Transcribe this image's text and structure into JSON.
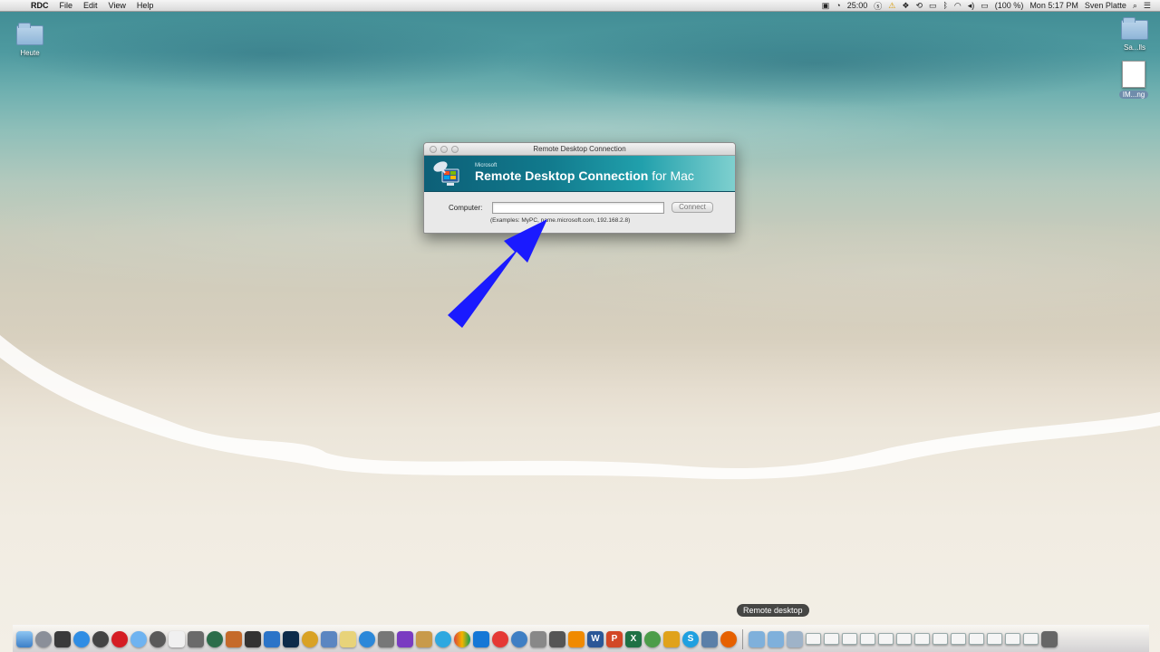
{
  "menubar": {
    "app": "RDC",
    "items": [
      "File",
      "Edit",
      "View",
      "Help"
    ],
    "time_remaining": "25:00",
    "battery": "(100 %)",
    "clock": "Mon 5:17 PM",
    "user": "Sven Platte"
  },
  "desktop": {
    "icons": [
      {
        "label": "Heute"
      },
      {
        "label": "Sa...lls"
      },
      {
        "label": "IM...ng"
      }
    ]
  },
  "window": {
    "title": "Remote Desktop Connection",
    "banner_brand": "Microsoft",
    "banner_product_bold": "Remote Desktop Connection",
    "banner_product_rest": " for Mac",
    "computer_label": "Computer:",
    "computer_value": "",
    "connect_label": "Connect",
    "examples_text": "(Examples: MyPC, name.microsoft.com, 192.168.2.8)"
  },
  "tooltip": "Remote desktop",
  "colors": {
    "arrow": "#1a1aff",
    "banner": "#117a8d"
  },
  "dock": {
    "icons": [
      "finder-icon",
      "rocket-icon",
      "mission-control-icon",
      "safari-icon",
      "radar-icon",
      "opera-icon",
      "messages-icon",
      "itunes-icon",
      "calendar-icon",
      "system-icon",
      "time-machine-icon",
      "activity-icon",
      "pen-icon",
      "chart-icon",
      "photoshop-icon",
      "headphones-icon",
      "preview-icon",
      "stickies-icon",
      "app-store-icon",
      "utility-icon",
      "purple-app-icon",
      "book-icon",
      "skype-blue-icon",
      "chrome-icon",
      "teamviewer-icon",
      "tomato-icon",
      "globe-icon",
      "camera-icon",
      "calc-icon",
      "vlc-icon",
      "word-icon",
      "powerpoint-icon",
      "excel-icon",
      "vpn-icon",
      "remote-icon",
      "s-icon",
      "rdc-icon",
      "firefox-icon"
    ]
  }
}
